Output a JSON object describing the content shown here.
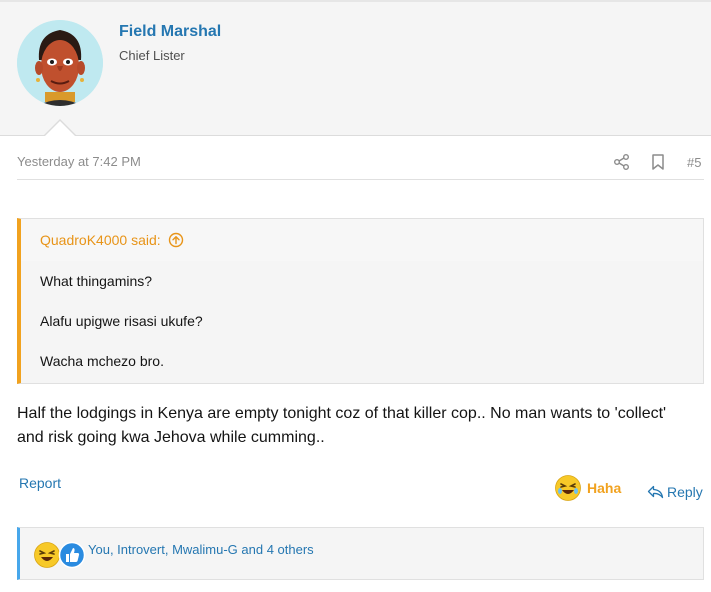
{
  "user": {
    "name": "Field Marshal",
    "title": "Chief Lister"
  },
  "post": {
    "timestamp": "Yesterday at 7:42 PM",
    "number": "#5",
    "quote": {
      "author_label": "QuadroK4000 said:",
      "lines": [
        "What thingamins?",
        "Alafu upigwe risasi ukufe?",
        "Wacha mchezo bro."
      ]
    },
    "body": "Half the lodgings in Kenya are empty tonight coz of that killer cop.. No man wants to 'collect' and risk going kwa Jehova while cumming..",
    "actions": {
      "report": "Report",
      "reaction": "Haha",
      "reply": "Reply"
    },
    "reactions_summary": "You, Introvert, Mwalimu-G and 4 others"
  },
  "colors": {
    "link": "#2577b1",
    "quote_accent": "#f1a21f",
    "reactions_accent": "#47a7eb"
  },
  "icons": {
    "share": "share-icon",
    "bookmark": "bookmark-icon",
    "quote_jump": "arrow-up-circle-icon",
    "haha": "laughing-emoji-icon",
    "like": "thumbs-up-icon",
    "reply": "reply-arrow-icon"
  }
}
